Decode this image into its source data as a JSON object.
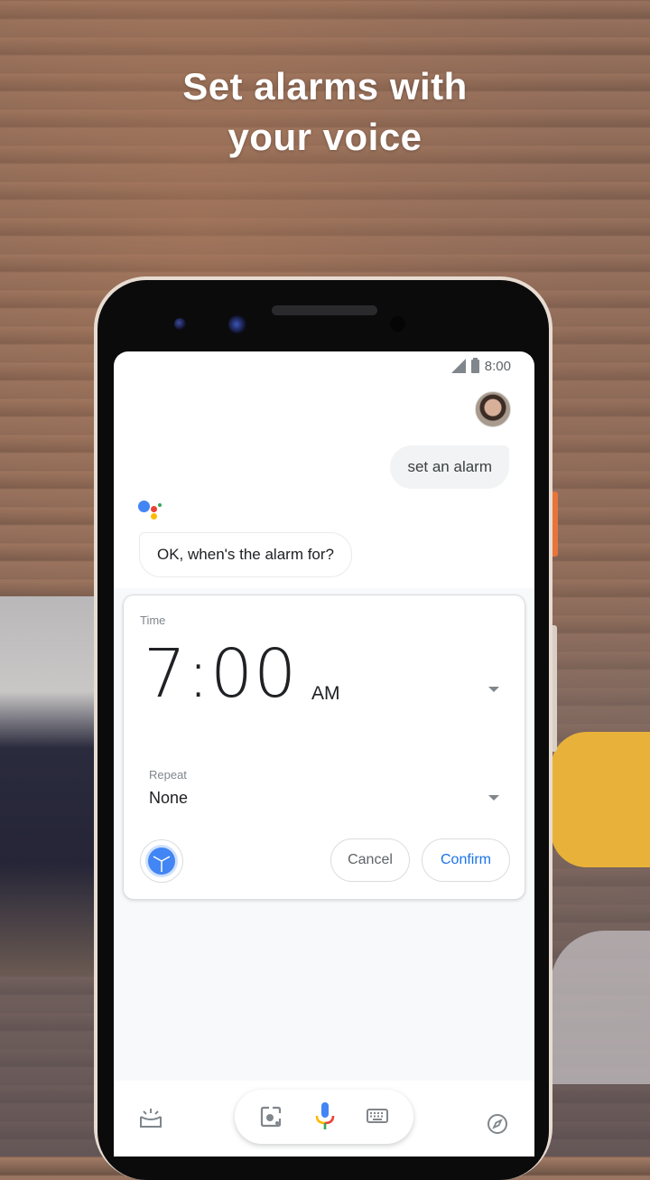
{
  "headline": {
    "line1": "Set alarms with",
    "line2": "your voice"
  },
  "status_bar": {
    "time": "8:00",
    "signal_icon": "cell-signal-icon",
    "battery_icon": "battery-icon"
  },
  "conversation": {
    "user_message": "set an alarm",
    "assistant_message": "OK, when's the alarm for?"
  },
  "alarm_card": {
    "time_label": "Time",
    "time_value": "7:00",
    "period": "AM",
    "repeat_label": "Repeat",
    "repeat_value": "None",
    "cancel_label": "Cancel",
    "confirm_label": "Confirm"
  },
  "bottom_nav": {
    "left_icon": "updates-tray-icon",
    "lens_icon": "lens-icon",
    "mic_icon": "microphone-icon",
    "keyboard_icon": "keyboard-icon",
    "right_icon": "explore-compass-icon"
  },
  "colors": {
    "google_blue": "#4285F4",
    "google_red": "#EA4335",
    "google_yellow": "#FBBC05",
    "google_green": "#34A853",
    "confirm_text": "#1A73E8"
  }
}
